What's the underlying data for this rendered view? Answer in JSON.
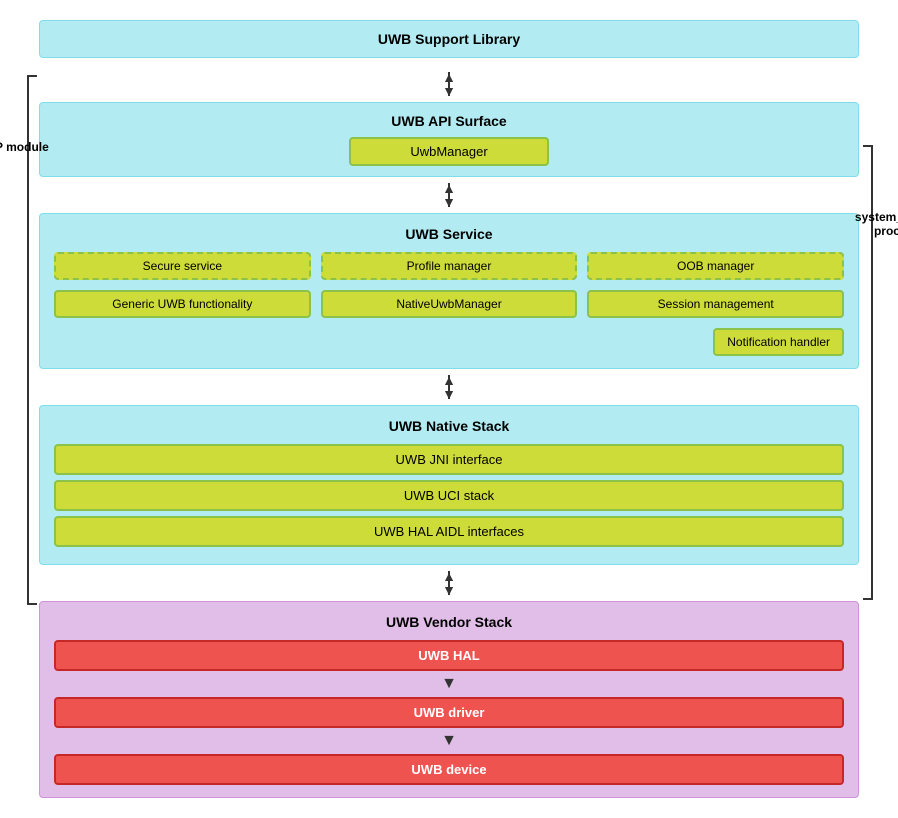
{
  "labels": {
    "aosp_module": "AOSP module",
    "system_server": "system_server",
    "process": "process"
  },
  "sections": {
    "support_library": {
      "title": "UWB Support Library"
    },
    "api_surface": {
      "title": "UWB API Surface",
      "uwb_manager": "UwbManager"
    },
    "uwb_service": {
      "title": "UWB Service",
      "row1": [
        "Secure service",
        "Profile manager",
        "OOB manager"
      ],
      "row2": [
        "Generic UWB functionality",
        "NativeUwbManager",
        "Session management"
      ],
      "row3": [
        "Notification handler"
      ]
    },
    "native_stack": {
      "title": "UWB Native Stack",
      "items": [
        "UWB JNI interface",
        "UWB UCI stack",
        "UWB HAL AIDL interfaces"
      ]
    },
    "vendor_stack": {
      "title": "UWB Vendor Stack",
      "items": [
        "UWB HAL",
        "UWB driver",
        "UWB device"
      ]
    }
  }
}
